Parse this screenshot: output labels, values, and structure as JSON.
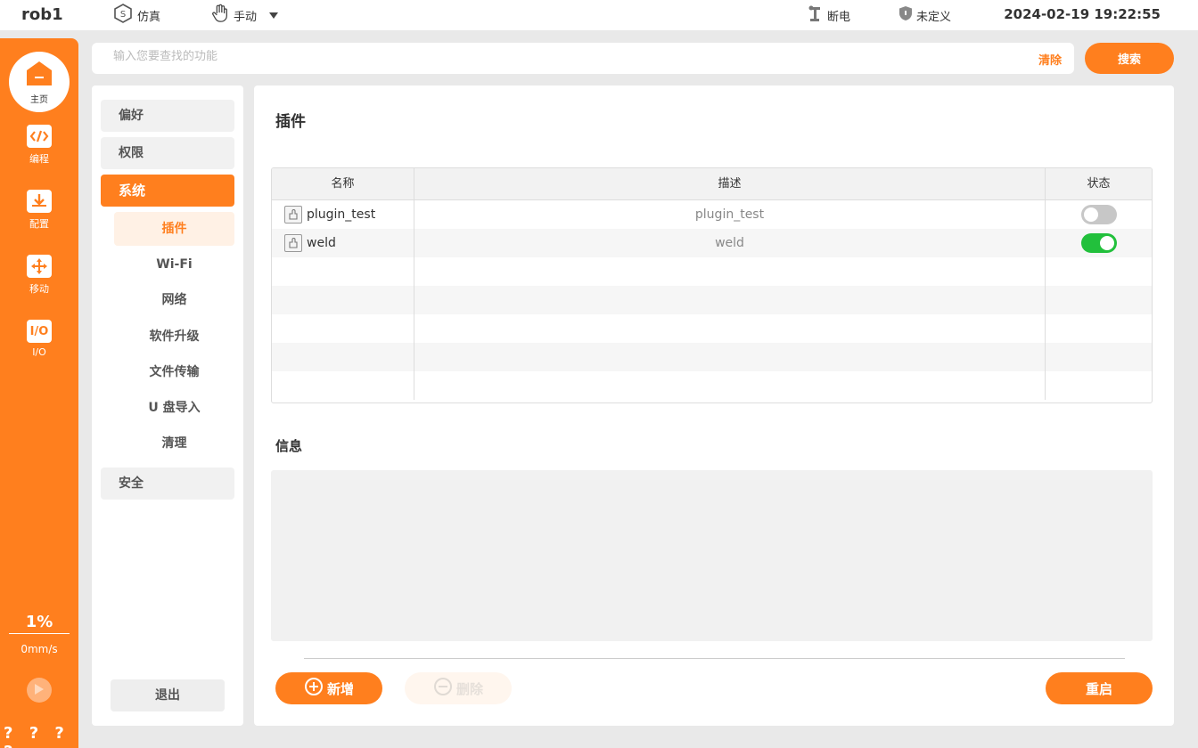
{
  "topbar": {
    "robot_name": "rob1",
    "sim_label": "仿真",
    "mode_label": "手动",
    "power_label": "断电",
    "tool_label": "未定义",
    "datetime": "2024-02-19 19:22:55"
  },
  "sidebar": {
    "home_label": "主页",
    "items": [
      {
        "label": "编程",
        "icon": "code-icon"
      },
      {
        "label": "配置",
        "icon": "download-box-icon"
      },
      {
        "label": "移动",
        "icon": "move-arrows-icon"
      },
      {
        "label": "I/O",
        "icon": "io-icon"
      }
    ],
    "speed_percent": "1%",
    "speed_value": "0mm/s",
    "help_text": "? ? ? ?"
  },
  "search": {
    "placeholder": "输入您要查找的功能",
    "clear_label": "清除",
    "button_label": "搜索"
  },
  "menu": {
    "categories": [
      "偏好",
      "权限",
      "系统",
      "安全"
    ],
    "sub_items": [
      "插件",
      "Wi-Fi",
      "网络",
      "软件升级",
      "文件传输",
      "U 盘导入",
      "清理"
    ],
    "logout_label": "退出"
  },
  "main": {
    "title": "插件",
    "table": {
      "headers": [
        "名称",
        "描述",
        "状态"
      ],
      "rows": [
        {
          "name": "plugin_test",
          "description": "plugin_test",
          "enabled": false
        },
        {
          "name": "weld",
          "description": "weld",
          "enabled": true
        }
      ]
    },
    "info_title": "信息",
    "add_label": "新增",
    "delete_label": "删除",
    "restart_label": "重启"
  },
  "colors": {
    "accent": "#ff7f1e",
    "toggle_on": "#22c03c",
    "toggle_off": "#c7c7c7"
  }
}
